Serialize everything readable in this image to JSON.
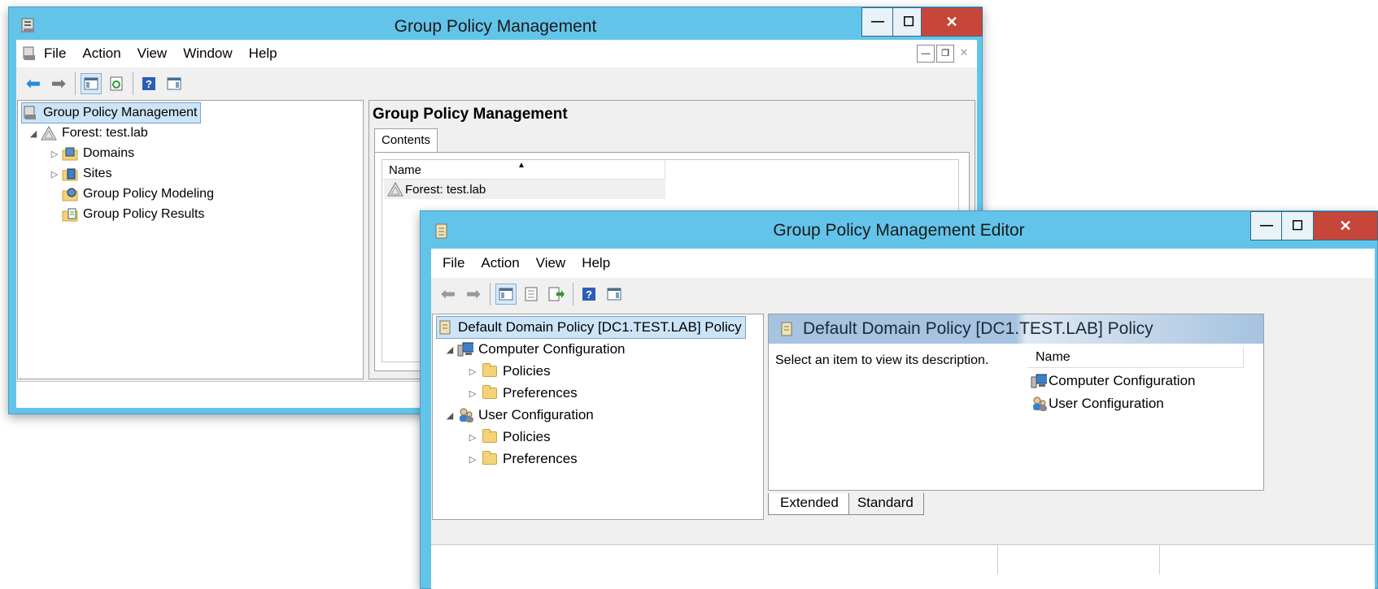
{
  "gpm": {
    "title": "Group Policy Management",
    "menu": [
      "File",
      "Action",
      "View",
      "Window",
      "Help"
    ],
    "tree": {
      "root": "Group Policy Management",
      "forest": "Forest: test.lab",
      "domains": "Domains",
      "sites": "Sites",
      "modeling": "Group Policy Modeling",
      "results": "Group Policy Results"
    },
    "right": {
      "heading": "Group Policy Management",
      "tab": "Contents",
      "col_name": "Name",
      "row": "Forest: test.lab"
    }
  },
  "editor": {
    "title": "Group Policy Management Editor",
    "menu": [
      "File",
      "Action",
      "View",
      "Help"
    ],
    "tree": {
      "root": "Default Domain Policy [DC1.TEST.LAB] Policy",
      "computer": "Computer Configuration",
      "comp_policies": "Policies",
      "comp_prefs": "Preferences",
      "user": "User Configuration",
      "user_policies": "Policies",
      "user_prefs": "Preferences"
    },
    "right": {
      "heading": "Default Domain Policy [DC1.TEST.LAB] Policy",
      "description": "Select an item to view its description.",
      "col_name": "Name",
      "items": [
        "Computer Configuration",
        "User Configuration"
      ]
    },
    "tabs": [
      "Extended",
      "Standard"
    ]
  },
  "icons": {
    "back": "back-arrow-icon",
    "forward": "forward-arrow-icon",
    "help": "help-icon"
  },
  "colors": {
    "titlebar": "#63c4ea",
    "close": "#c7463a",
    "selection": "#cce4f7",
    "header_band": "#a6c3e0"
  }
}
